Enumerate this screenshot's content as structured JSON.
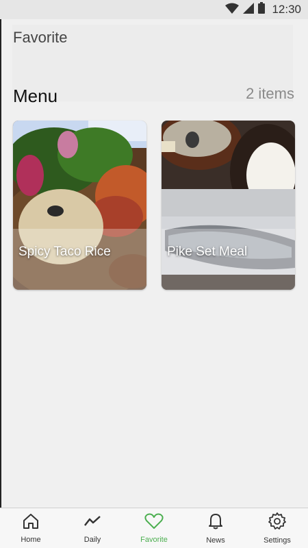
{
  "status_bar": {
    "time": "12:30",
    "icons": [
      "wifi-icon",
      "cell-signal-icon",
      "battery-icon"
    ]
  },
  "header": {
    "title": "Favorite"
  },
  "menu": {
    "title": "Menu",
    "count": "2 items",
    "items": [
      {
        "name": "Spicy Taco Rice"
      },
      {
        "name": "Pike Set Meal"
      }
    ]
  },
  "bottom_nav": {
    "items": [
      {
        "label": "Home",
        "icon": "home-icon",
        "active": false
      },
      {
        "label": "Daily",
        "icon": "trend-line-icon",
        "active": false
      },
      {
        "label": "Favorite",
        "icon": "heart-icon",
        "active": true
      },
      {
        "label": "News",
        "icon": "bell-icon",
        "active": false
      },
      {
        "label": "Settings",
        "icon": "gear-icon",
        "active": false
      }
    ],
    "active_color": "#4caf50"
  }
}
